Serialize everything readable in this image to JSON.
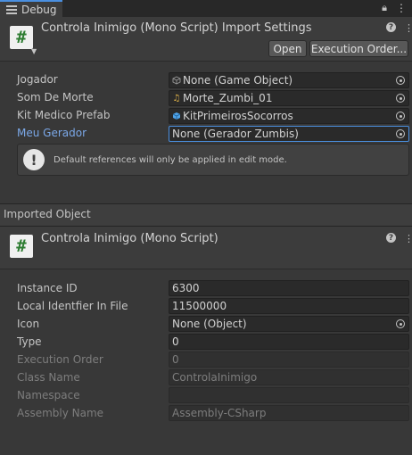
{
  "tab": {
    "label": "Debug"
  },
  "import_header": {
    "title": "Controla Inimigo (Mono Script) Import Settings",
    "open_label": "Open",
    "execution_order_label": "Execution Order..."
  },
  "references": [
    {
      "label": "Jogador",
      "value": "None (Game Object)",
      "icon": "cube-icon"
    },
    {
      "label": "Som De Morte",
      "value": "Morte_Zumbi_01",
      "icon": "audio-icon"
    },
    {
      "label": "Kit Medico Prefab",
      "value": "KitPrimeirosSocorros",
      "icon": "prefab-icon"
    },
    {
      "label": "Meu Gerador",
      "value": "None (Gerador Zumbis)",
      "icon": ""
    }
  ],
  "help": {
    "text": "Default references will only be applied in edit mode."
  },
  "imported": {
    "section_title": "Imported Object",
    "title": "Controla Inimigo (Mono Script)",
    "instance_id_label": "Instance ID",
    "instance_id": "6300",
    "local_id_label": "Local Identfier In File",
    "local_id": "11500000",
    "icon_label": "Icon",
    "icon_value": "None (Object)",
    "type_label": "Type",
    "type_value": "0",
    "exec_order_label": "Execution Order",
    "exec_order": "0",
    "class_name_label": "Class Name",
    "class_name": "ControlaInimigo",
    "namespace_label": "Namespace",
    "namespace": "",
    "assembly_label": "Assembly Name",
    "assembly": "Assembly-CSharp"
  },
  "glyphs": {
    "script": "#",
    "help": "?",
    "menu": "⋮",
    "lock": "🔒",
    "warn": "!"
  },
  "colors": {
    "accent": "#4a8fe0",
    "script_hash": "#2e7d32",
    "label_blue": "#7ba8e8"
  }
}
